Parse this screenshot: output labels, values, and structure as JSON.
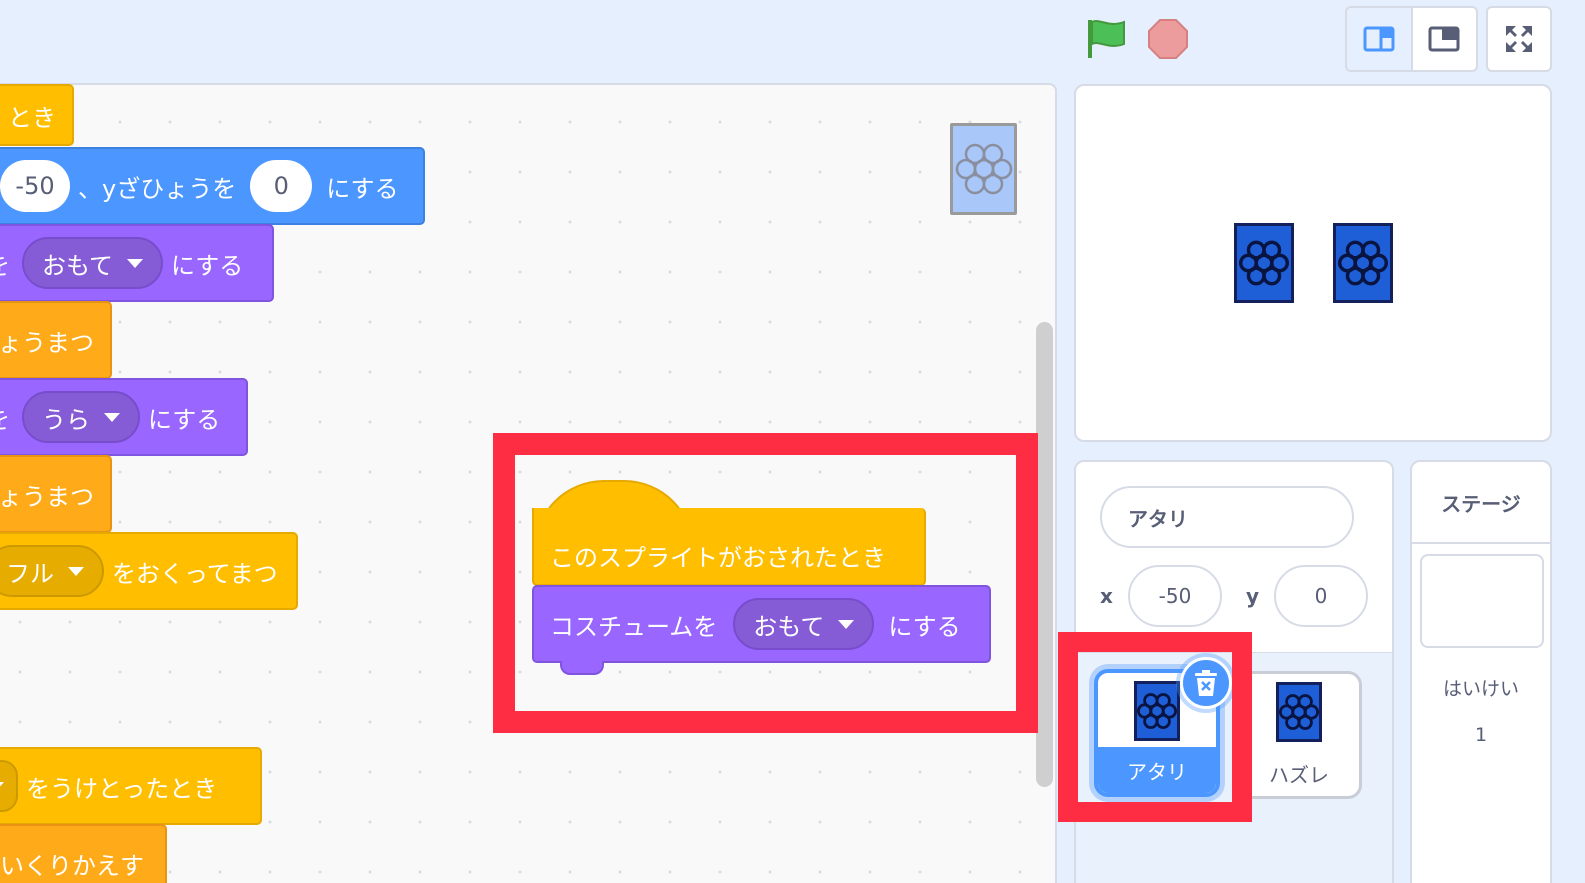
{
  "blocks": {
    "b1_text": "とき",
    "b2_x_value": "-50",
    "b2_mid": "、yざひょうを",
    "b2_y_value": "0",
    "b2_end": "にする",
    "b3_pre": "を",
    "b3_dropdown": "おもて",
    "b3_end": "にする",
    "b4_text": "ょうまつ",
    "b5_pre": "を",
    "b5_dropdown": "うら",
    "b5_end": "にする",
    "b6_text": "ょうまつ",
    "b7_dropdown": "フル",
    "b7_end": "をおくってまつ",
    "b8_end": "をうけとったとき",
    "b9_text": "いくりかえす"
  },
  "highlighted_script": {
    "hat_label": "このスプライトがおされたとき",
    "costume_label": "コスチュームを",
    "costume_dropdown": "おもて",
    "costume_end": "にする"
  },
  "sprite_info": {
    "name": "アタリ",
    "x_label": "x",
    "x_value": "-50",
    "y_label": "y",
    "y_value": "0"
  },
  "sprites": [
    {
      "name": "アタリ",
      "selected": true
    },
    {
      "name": "ハズレ",
      "selected": false
    }
  ],
  "stage_panel": {
    "title": "ステージ",
    "backdrop_label": "はいけい",
    "backdrop_count": "1"
  },
  "colors": {
    "events": "#ffbf00",
    "motion": "#4c97ff",
    "looks": "#9966ff",
    "control": "#ffab19",
    "highlight": "#fe2d44"
  },
  "icons": {
    "flag": "green-flag-icon",
    "stop": "stop-icon",
    "delete": "trash-icon"
  }
}
